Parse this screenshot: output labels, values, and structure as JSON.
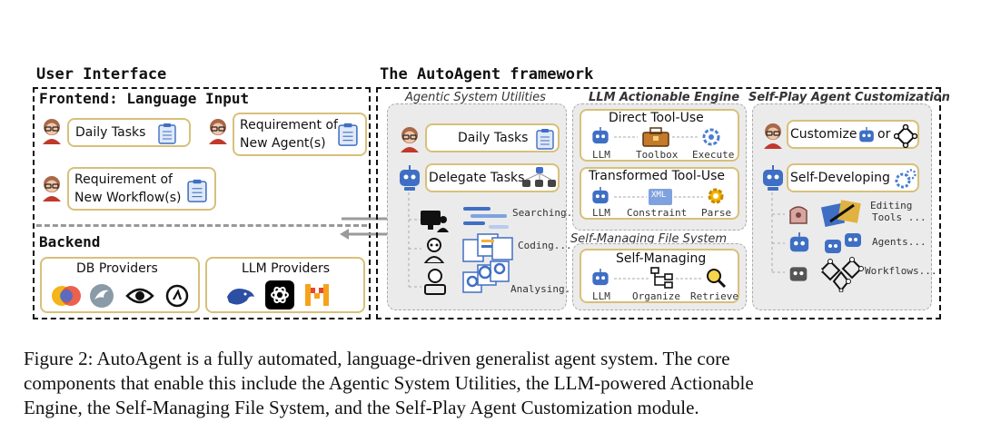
{
  "ui": {
    "title": "User Interface",
    "frontend_title": "Frontend: Language Input",
    "daily_tasks": "Daily Tasks",
    "req_agent_line1": "Requirement of",
    "req_agent_line2": "New Agent(s)",
    "req_workflow_line1": "Requirement of",
    "req_workflow_line2": "New Workflow(s)",
    "backend_title": "Backend",
    "db_providers": "DB Providers",
    "llm_providers": "LLM Providers"
  },
  "framework": {
    "title": "The AutoAgent framework",
    "utilities": {
      "title": "Agentic System Utilities",
      "daily_tasks": "Daily Tasks",
      "delegate_tasks": "Delegate Tasks",
      "searching": "Searching...",
      "coding": "Coding...",
      "analysing": "Analysing..."
    },
    "engine": {
      "title": "LLM Actionable Engine",
      "direct": "Direct Tool-Use",
      "transformed": "Transformed Tool-Use",
      "llm": "LLM",
      "toolbox": "Toolbox",
      "execute": "Execute",
      "constraint": "Constraint",
      "parse": "Parse",
      "xml": "XML"
    },
    "file_system": {
      "title": "Self-Managing File System",
      "self_managing": "Self-Managing",
      "llm": "LLM",
      "organize": "Organize",
      "retrieve": "Retrieve"
    },
    "customization": {
      "title": "Self-Play Agent Customization",
      "customize": "Customize",
      "or": "or",
      "self_developing": "Self-Developing",
      "editing_tools_1": "Editing",
      "editing_tools_2": "Tools ...",
      "agents": "Agents...",
      "workflows": "Workflows..."
    }
  },
  "caption": {
    "line1": "Figure 2: AutoAgent is a fully automated, language-driven generalist agent system. The core",
    "line2": "components that enable this include the Agentic System Utilities, the LLM-powered Actionable",
    "line3": "Engine, the Self-Managing File System, and the Self-Play Agent Customization module."
  },
  "colors": {
    "card_border": "#d8c07a",
    "panel_bg": "#ebebeb",
    "robot_blue": "#3f6fc4",
    "gear_blue": "#4a7fd1"
  }
}
